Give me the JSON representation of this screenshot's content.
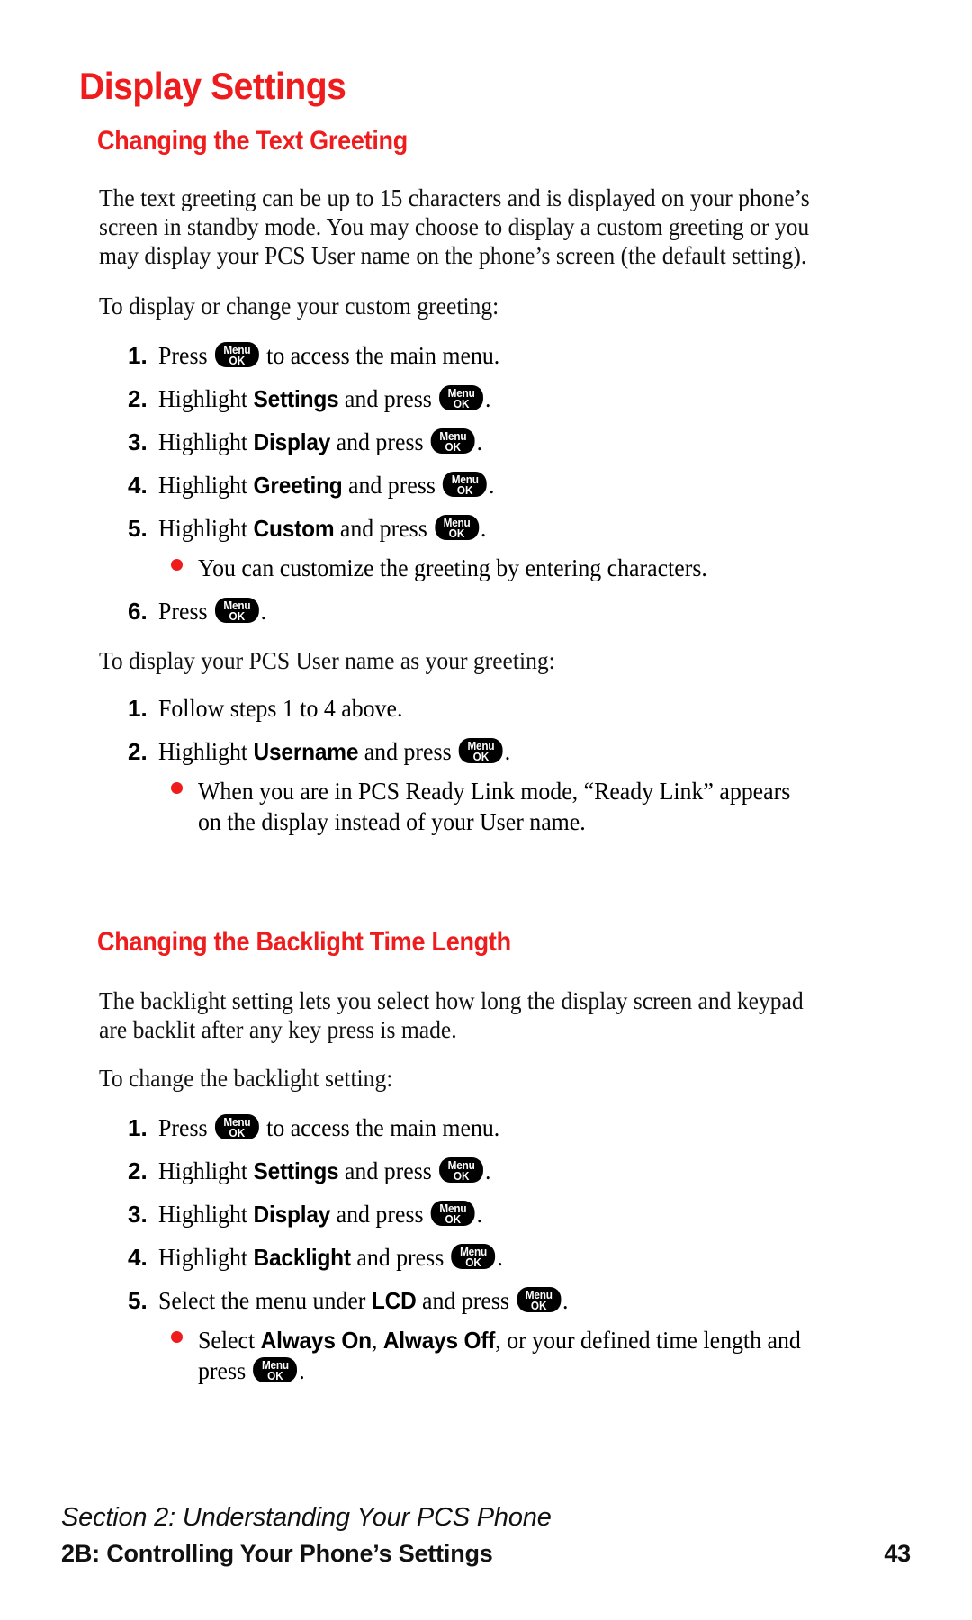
{
  "page": {
    "title": "Display Settings",
    "page_number": "43",
    "accent_color": "#ee1c1c",
    "key_icon": {
      "top": "Menu",
      "bottom": "OK"
    }
  },
  "section1": {
    "heading": "Changing the Text Greeting",
    "intro": "The text greeting can be up to 15 characters and is displayed on your phone’s screen in standby mode. You may choose to display a custom greeting or you may display your PCS User name on the phone’s screen (the default setting).",
    "lead_custom": "To display or change your custom greeting:",
    "steps_custom": [
      {
        "num": "1.",
        "pre": "Press ",
        "bold": "",
        "mid": "",
        "key": true,
        "post": " to access the main menu."
      },
      {
        "num": "2.",
        "pre": "Highlight ",
        "bold": "Settings",
        "mid": " and press ",
        "key": true,
        "post": "."
      },
      {
        "num": "3.",
        "pre": "Highlight ",
        "bold": "Display",
        "mid": " and press ",
        "key": true,
        "post": "."
      },
      {
        "num": "4.",
        "pre": "Highlight ",
        "bold": "Greeting",
        "mid": " and press ",
        "key": true,
        "post": "."
      },
      {
        "num": "5.",
        "pre": "Highlight ",
        "bold": "Custom",
        "mid": " and press ",
        "key": true,
        "post": "."
      }
    ],
    "bullet_custom": "You can customize the greeting by entering characters.",
    "step6": {
      "num": "6.",
      "pre": "Press ",
      "key": true,
      "post": "."
    },
    "lead_username": "To display your PCS User name as your greeting:",
    "steps_username": [
      {
        "num": "1.",
        "pre": "Follow steps 1 to 4 above.",
        "bold": "",
        "mid": "",
        "key": false,
        "post": ""
      },
      {
        "num": "2.",
        "pre": "Highlight ",
        "bold": "Username",
        "mid": " and press ",
        "key": true,
        "post": "."
      }
    ],
    "bullet_username": "When you are in PCS Ready Link mode, “Ready Link” appears on the display instead of your User name."
  },
  "section2": {
    "heading": "Changing the Backlight Time Length",
    "intro": "The backlight setting lets you select how long the display screen and keypad are backlit after any key press is made.",
    "lead": "To change the backlight setting:",
    "steps": [
      {
        "num": "1.",
        "pre": "Press ",
        "bold": "",
        "mid": "",
        "key": true,
        "post": " to access the main menu."
      },
      {
        "num": "2.",
        "pre": "Highlight ",
        "bold": "Settings",
        "mid": " and press ",
        "key": true,
        "post": "."
      },
      {
        "num": "3.",
        "pre": "Highlight ",
        "bold": "Display",
        "mid": " and press ",
        "key": true,
        "post": "."
      },
      {
        "num": "4.",
        "pre": "Highlight ",
        "bold": "Backlight",
        "mid": " and press ",
        "key": true,
        "post": "."
      },
      {
        "num": "5.",
        "pre": "Select the menu under ",
        "bold": "LCD",
        "mid": " and press ",
        "key": true,
        "post": "."
      }
    ],
    "bullet": {
      "pre": "Select ",
      "bold1": "Always On",
      "mid1": ", ",
      "bold2": "Always Off",
      "mid2": ", or your defined time length and press ",
      "post": "."
    }
  },
  "footer": {
    "section_line": "Section 2: Understanding Your PCS Phone",
    "chapter_line": "2B: Controlling Your Phone’s Settings",
    "page_number": "43"
  }
}
